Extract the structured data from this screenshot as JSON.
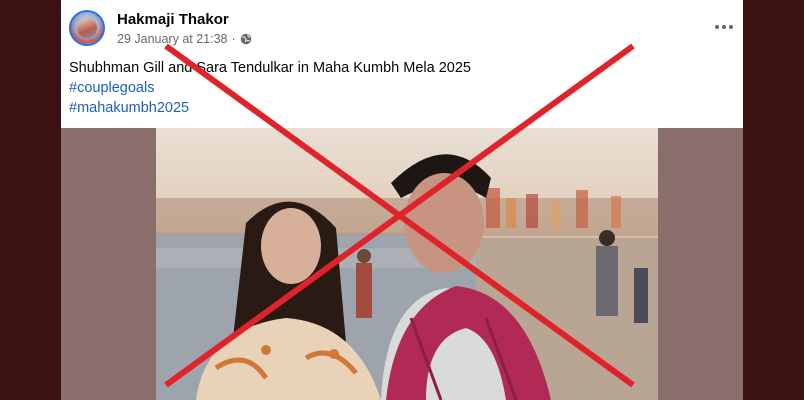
{
  "post": {
    "author": "Hakmaji Thakor",
    "timestamp": "29 January at 21:38",
    "separator": "·",
    "privacy_icon": "globe-icon",
    "more_icon": "more-options-icon",
    "caption": "Shubhman Gill and Sara Tendulkar in Maha Kumbh Mela 2025",
    "hashtags": [
      "#couplegoals",
      "#mahakumbh2025"
    ]
  },
  "overlay": {
    "type": "red-x-cross",
    "color": "#e0222b"
  },
  "colors": {
    "frame": "#3b1212",
    "card": "#ffffff",
    "link": "#1b5fb8",
    "meta": "#65676b",
    "media_bg": "#8a6e6c"
  }
}
